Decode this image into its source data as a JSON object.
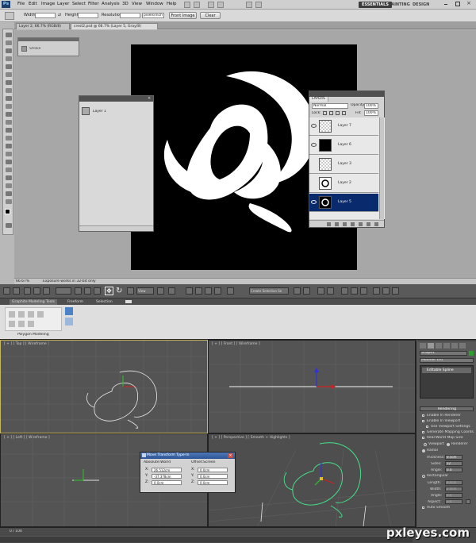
{
  "photoshop": {
    "app_badge": "Ps",
    "menu": [
      "File",
      "Edit",
      "Image",
      "Layer",
      "Select",
      "Filter",
      "Analysis",
      "3D",
      "View",
      "Window",
      "Help"
    ],
    "workspaces": [
      "ESSENTIALS",
      "PAINTING",
      "DESIGN"
    ],
    "options_bar": {
      "width_label": "Width:",
      "height_label": "Height:",
      "resolution_label": "Resolution:",
      "resolution_unit": "pixels/inch",
      "front_image_button": "Front Image",
      "clear_button": "Clear"
    },
    "tabs": [
      "Layer 2, 66.7% (RGB/8)",
      "crest2.psd @ 66.7% (Layer 5, Gray/8)"
    ],
    "float_panel_label": "Stroke",
    "panel_b_item": "Layer 1",
    "layers_panel": {
      "title": "LAYERS",
      "blend_mode": "Normal",
      "opacity_label": "Opacity:",
      "opacity_value": "100%",
      "lock_label": "Lock:",
      "fill_label": "Fill:",
      "fill_value": "100%",
      "layers": [
        "Layer 7",
        "Layer 6",
        "Layer 3",
        "Layer 2",
        "Layer 5"
      ]
    },
    "status": {
      "zoom": "66.67%",
      "message": "Exposure works in 32-bit only"
    }
  },
  "max": {
    "view_dropdown": "View",
    "selection_set": "Create Selection Se",
    "ribbon_tabs": [
      "Graphite Modeling Tools",
      "Freeform",
      "Selection"
    ],
    "ribbon_group": "Polygon Modeling",
    "viewports": {
      "top": "[ + ] [ Top ] [ Wireframe ]",
      "front": "[ + ] [ Front ] [ Wireframe ]",
      "left": "[ + ] [ Left ] [ Wireframe ]",
      "perspective": "[ + ] [ Perspective ] [ Smooth + Highlights ]"
    },
    "command_panel": {
      "object_name": "Shape1",
      "modifier_list": "Modifier List",
      "stack_item": "Editable Spline",
      "rollout": "Rendering",
      "checks": [
        "Enable In Renderer",
        "Enable In Viewport",
        "Use Viewport Settings",
        "Generate Mapping Coords.",
        "Real-World Map Size"
      ],
      "radios": [
        "Viewport",
        "Renderer"
      ],
      "radial_label": "Radial",
      "thickness_label": "Thickness:",
      "thickness_value": "0.5cm",
      "sides_label": "Sides:",
      "sides_value": "12",
      "angle_label": "Angle:",
      "angle_value": "0.0",
      "rectangular_label": "Rectangular",
      "length_label": "Length:",
      "length_value": "6.0cm",
      "width_label": "Width:",
      "width_value": "2.0cm",
      "angle2_value": "0.0",
      "aspect_label": "Aspect:",
      "aspect_value": "3.0",
      "auto_smooth": "Auto Smooth"
    },
    "move_dialog": {
      "title": "Move Transform Type-In",
      "absolute_label": "Absolute:World",
      "offset_label": "Offset:Screen",
      "axes": [
        "X:",
        "Y:",
        "Z:"
      ],
      "absolute_values": [
        "26.512cm",
        "-37.378cm",
        "0.0cm"
      ],
      "offset_values": [
        "0.0cm",
        "0.0cm",
        "0.0cm"
      ]
    },
    "timeline": "0 / 100"
  },
  "watermark": "pxleyes.com",
  "colors": {
    "ps_selected_layer": "#0a2a6e",
    "max_dialog_title": "#2d5596",
    "selected_spline": "#44dd88"
  }
}
